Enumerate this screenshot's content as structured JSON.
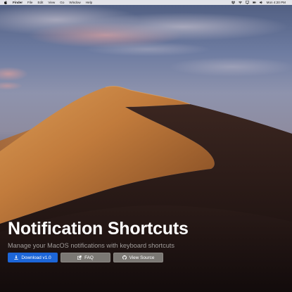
{
  "menubar": {
    "app_name": "Finder",
    "items": [
      "File",
      "Edit",
      "View",
      "Go",
      "Window",
      "Help"
    ],
    "status_icons": [
      "dropbox-icon",
      "wifi-icon",
      "screen-mirroring-icon",
      "battery-icon",
      "volume-icon"
    ],
    "clock": "Mon 4:20 PM"
  },
  "hero": {
    "title": "Notification Shortcuts",
    "subtitle": "Manage your MacOS notifications with keyboard shortcuts",
    "buttons": {
      "download": {
        "label": "Download v1.0",
        "icon": "download-icon",
        "color": "#1d66d8"
      },
      "faq": {
        "label": "FAQ",
        "icon": "external-link-icon",
        "color": "#7b7874"
      },
      "source": {
        "label": "View Source",
        "icon": "github-icon",
        "color": "#7b7874"
      }
    }
  },
  "wallpaper": "mojave-desert-dune"
}
